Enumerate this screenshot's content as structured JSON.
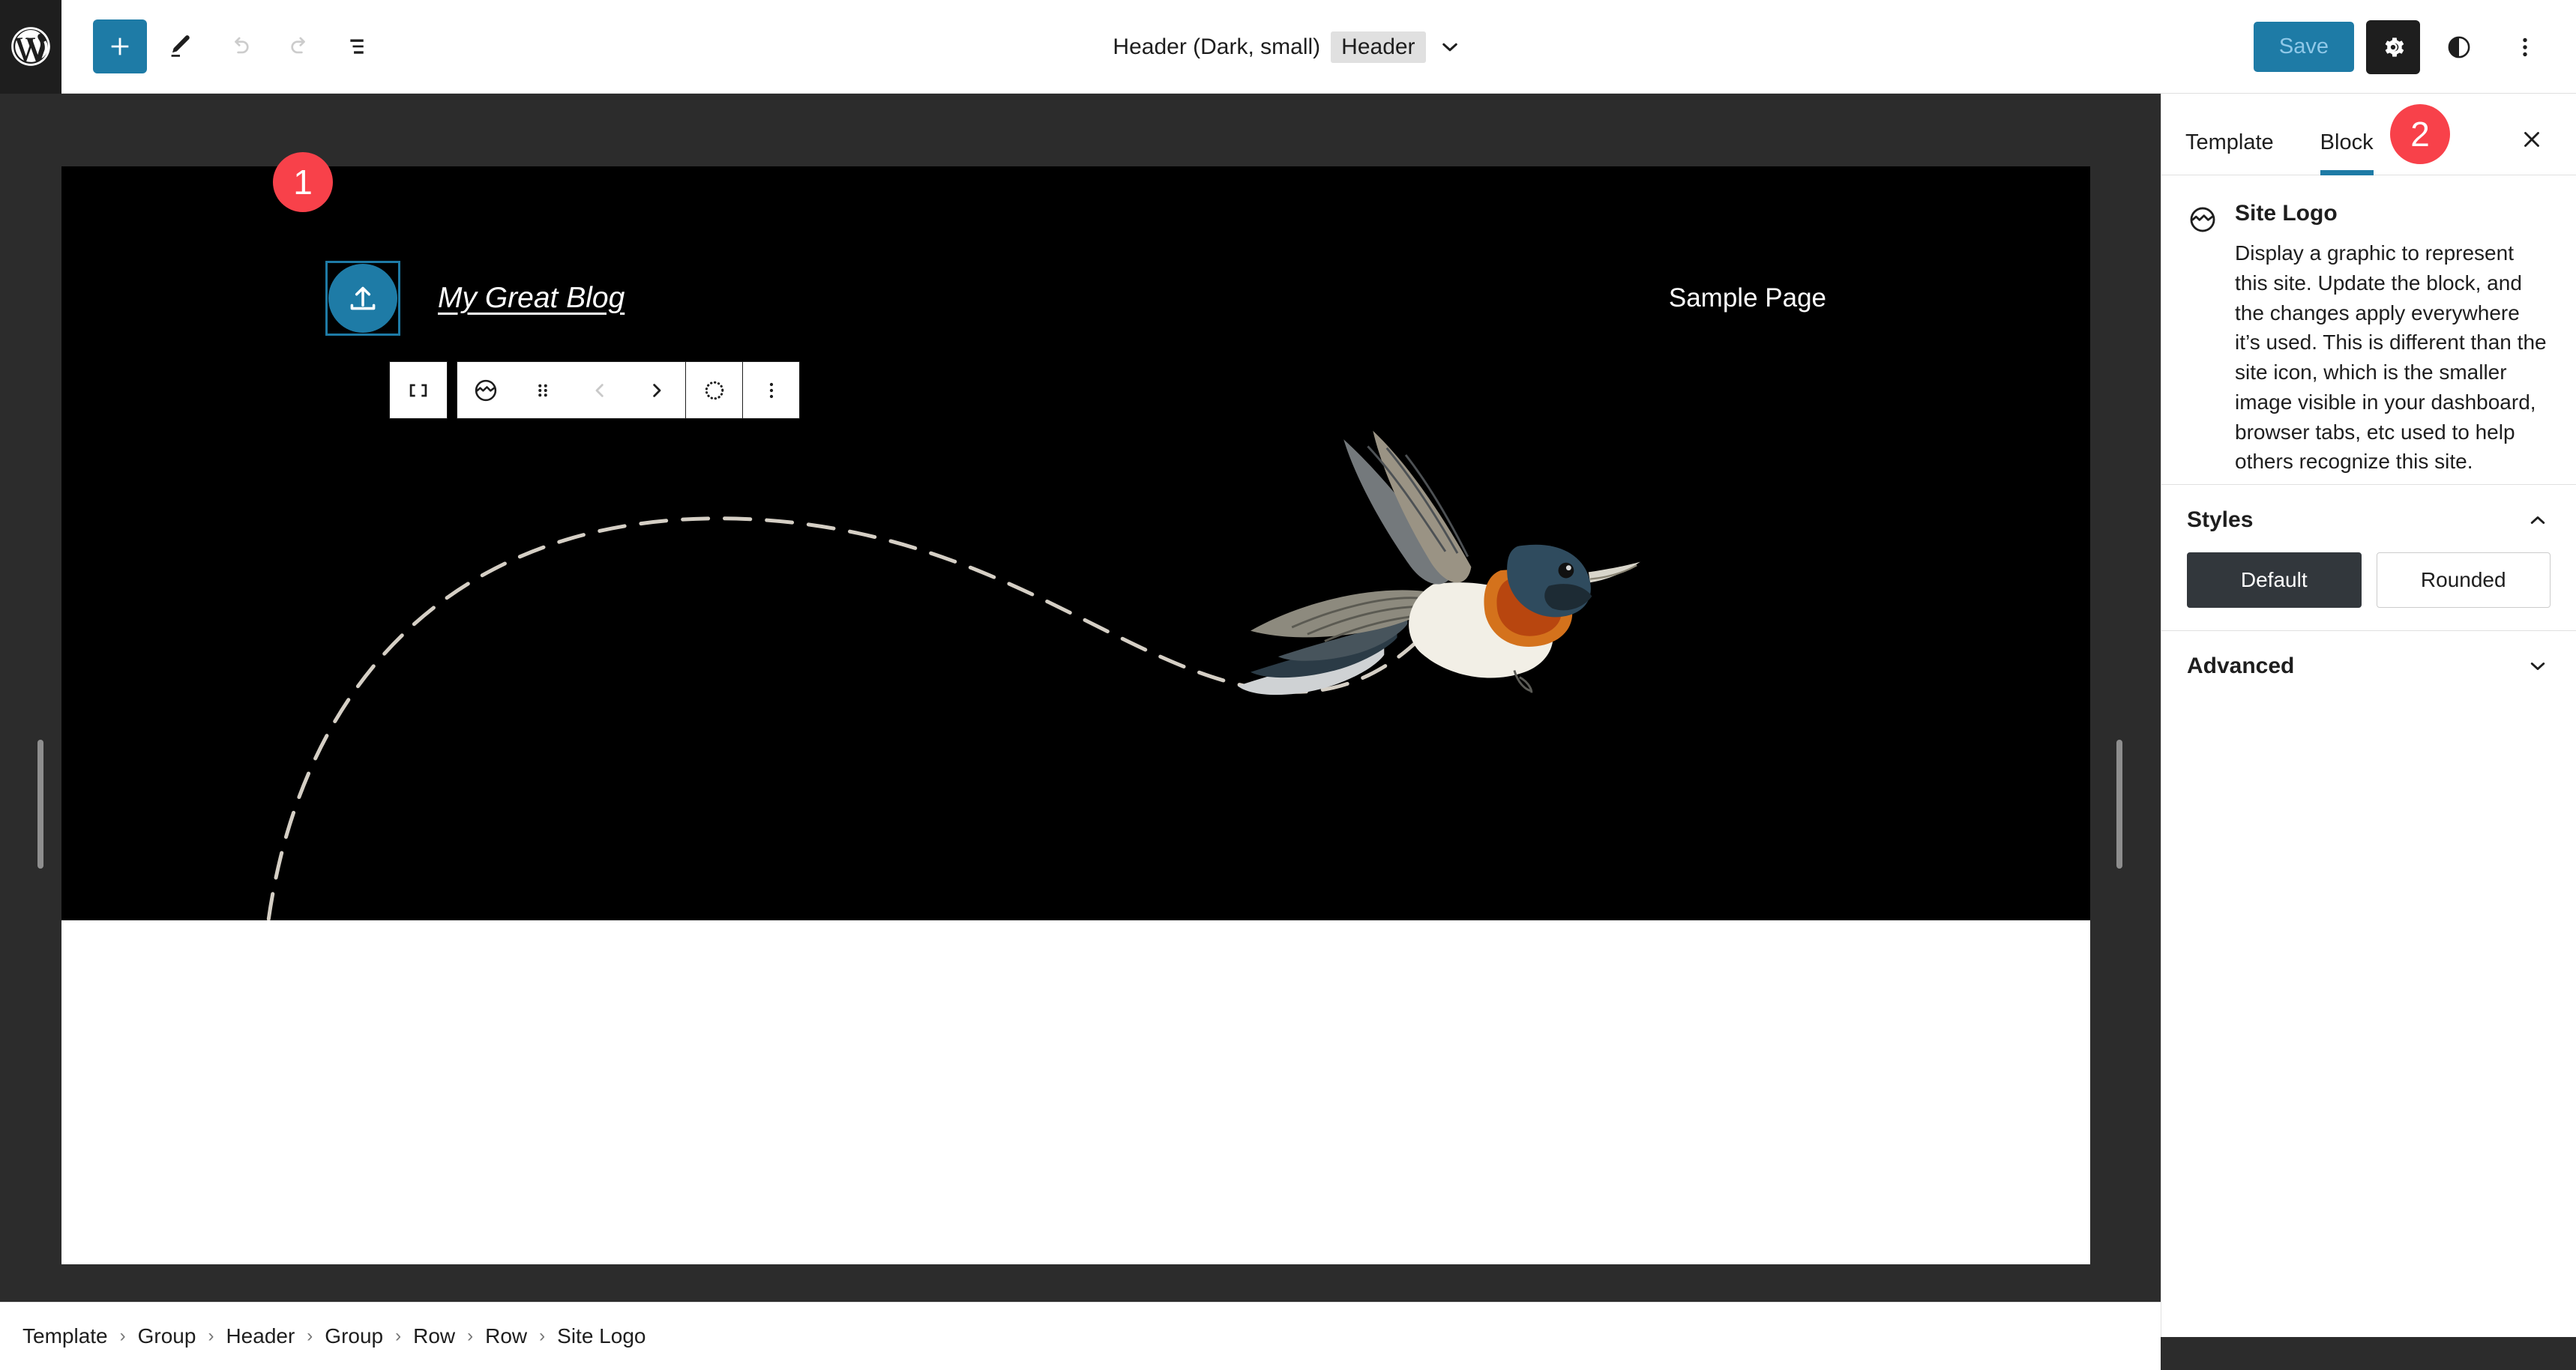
{
  "topbar": {
    "logo_icon": "wordpress-logo",
    "tools": [
      {
        "name": "add-block-button",
        "icon": "plus-icon",
        "label": "Add block"
      },
      {
        "name": "edit-tool-button",
        "icon": "pencil-icon",
        "label": "Edit"
      },
      {
        "name": "undo-button",
        "icon": "undo-arrow-icon",
        "label": "Undo"
      },
      {
        "name": "redo-button",
        "icon": "redo-arrow-icon",
        "label": "Redo"
      },
      {
        "name": "list-view-button",
        "icon": "list-view-icon",
        "label": "Document Overview"
      }
    ],
    "document_title": "Header (Dark, small)",
    "document_badge": "Header",
    "title_chevron_icon": "chevron-down-icon",
    "save_label": "Save",
    "settings_icon": "gear-icon",
    "styles_icon": "contrast-half-circle-icon",
    "more_icon": "three-dots-vertical-icon",
    "accent_color": "#1e7ba6",
    "save_text_color": "#8fc8e8"
  },
  "block_toolbar": {
    "items": [
      {
        "name": "change-alignment-button",
        "icon": "justify-align-icon"
      },
      {
        "name": "block-type-site-logo-button",
        "icon": "site-logo-icon"
      },
      {
        "name": "drag-handle",
        "icon": "drag-dots-icon"
      },
      {
        "name": "move-up-button",
        "icon": "chevron-left-icon",
        "disabled": true
      },
      {
        "name": "move-down-button",
        "icon": "chevron-right-icon",
        "disabled": false
      },
      {
        "name": "replace-media-button",
        "icon": "dotted-circle-icon"
      },
      {
        "name": "block-options-button",
        "icon": "three-dots-vertical-icon"
      }
    ]
  },
  "canvas": {
    "site_title": "My Great Blog",
    "nav_link": "Sample Page",
    "logo_placeholder_icon": "upload-arrow-icon",
    "logo_bg_color": "#1e7ba6",
    "header_bg_color": "#000000",
    "body_bg_color": "#ffffff",
    "dashed_line_color": "#d5cfc5",
    "bird_illustration": "flying-bird-illustration"
  },
  "sidebar": {
    "tabs": [
      {
        "label": "Template",
        "active": false
      },
      {
        "label": "Block",
        "active": true
      }
    ],
    "close_icon": "close-x-icon",
    "block": {
      "icon": "site-logo-icon",
      "title": "Site Logo",
      "description": "Display a graphic to represent this site. Update the block, and the changes apply everywhere it’s used. This is different than the site icon, which is the smaller image visible in your dashboard, browser tabs, etc used to help others recognize this site."
    },
    "styles_section": {
      "title": "Styles",
      "expanded": true,
      "chevron_icon": "chevron-up-icon",
      "options": [
        {
          "label": "Default",
          "selected": true
        },
        {
          "label": "Rounded",
          "selected": false
        }
      ]
    },
    "advanced_section": {
      "title": "Advanced",
      "expanded": false,
      "chevron_icon": "chevron-down-icon"
    }
  },
  "breadcrumb": {
    "separator": "›",
    "items": [
      "Template",
      "Group",
      "Header",
      "Group",
      "Row",
      "Row",
      "Site Logo"
    ]
  },
  "annotations": [
    {
      "label": "1",
      "target": "block-toolbar"
    },
    {
      "label": "2",
      "target": "sidebar-block-tab"
    }
  ]
}
